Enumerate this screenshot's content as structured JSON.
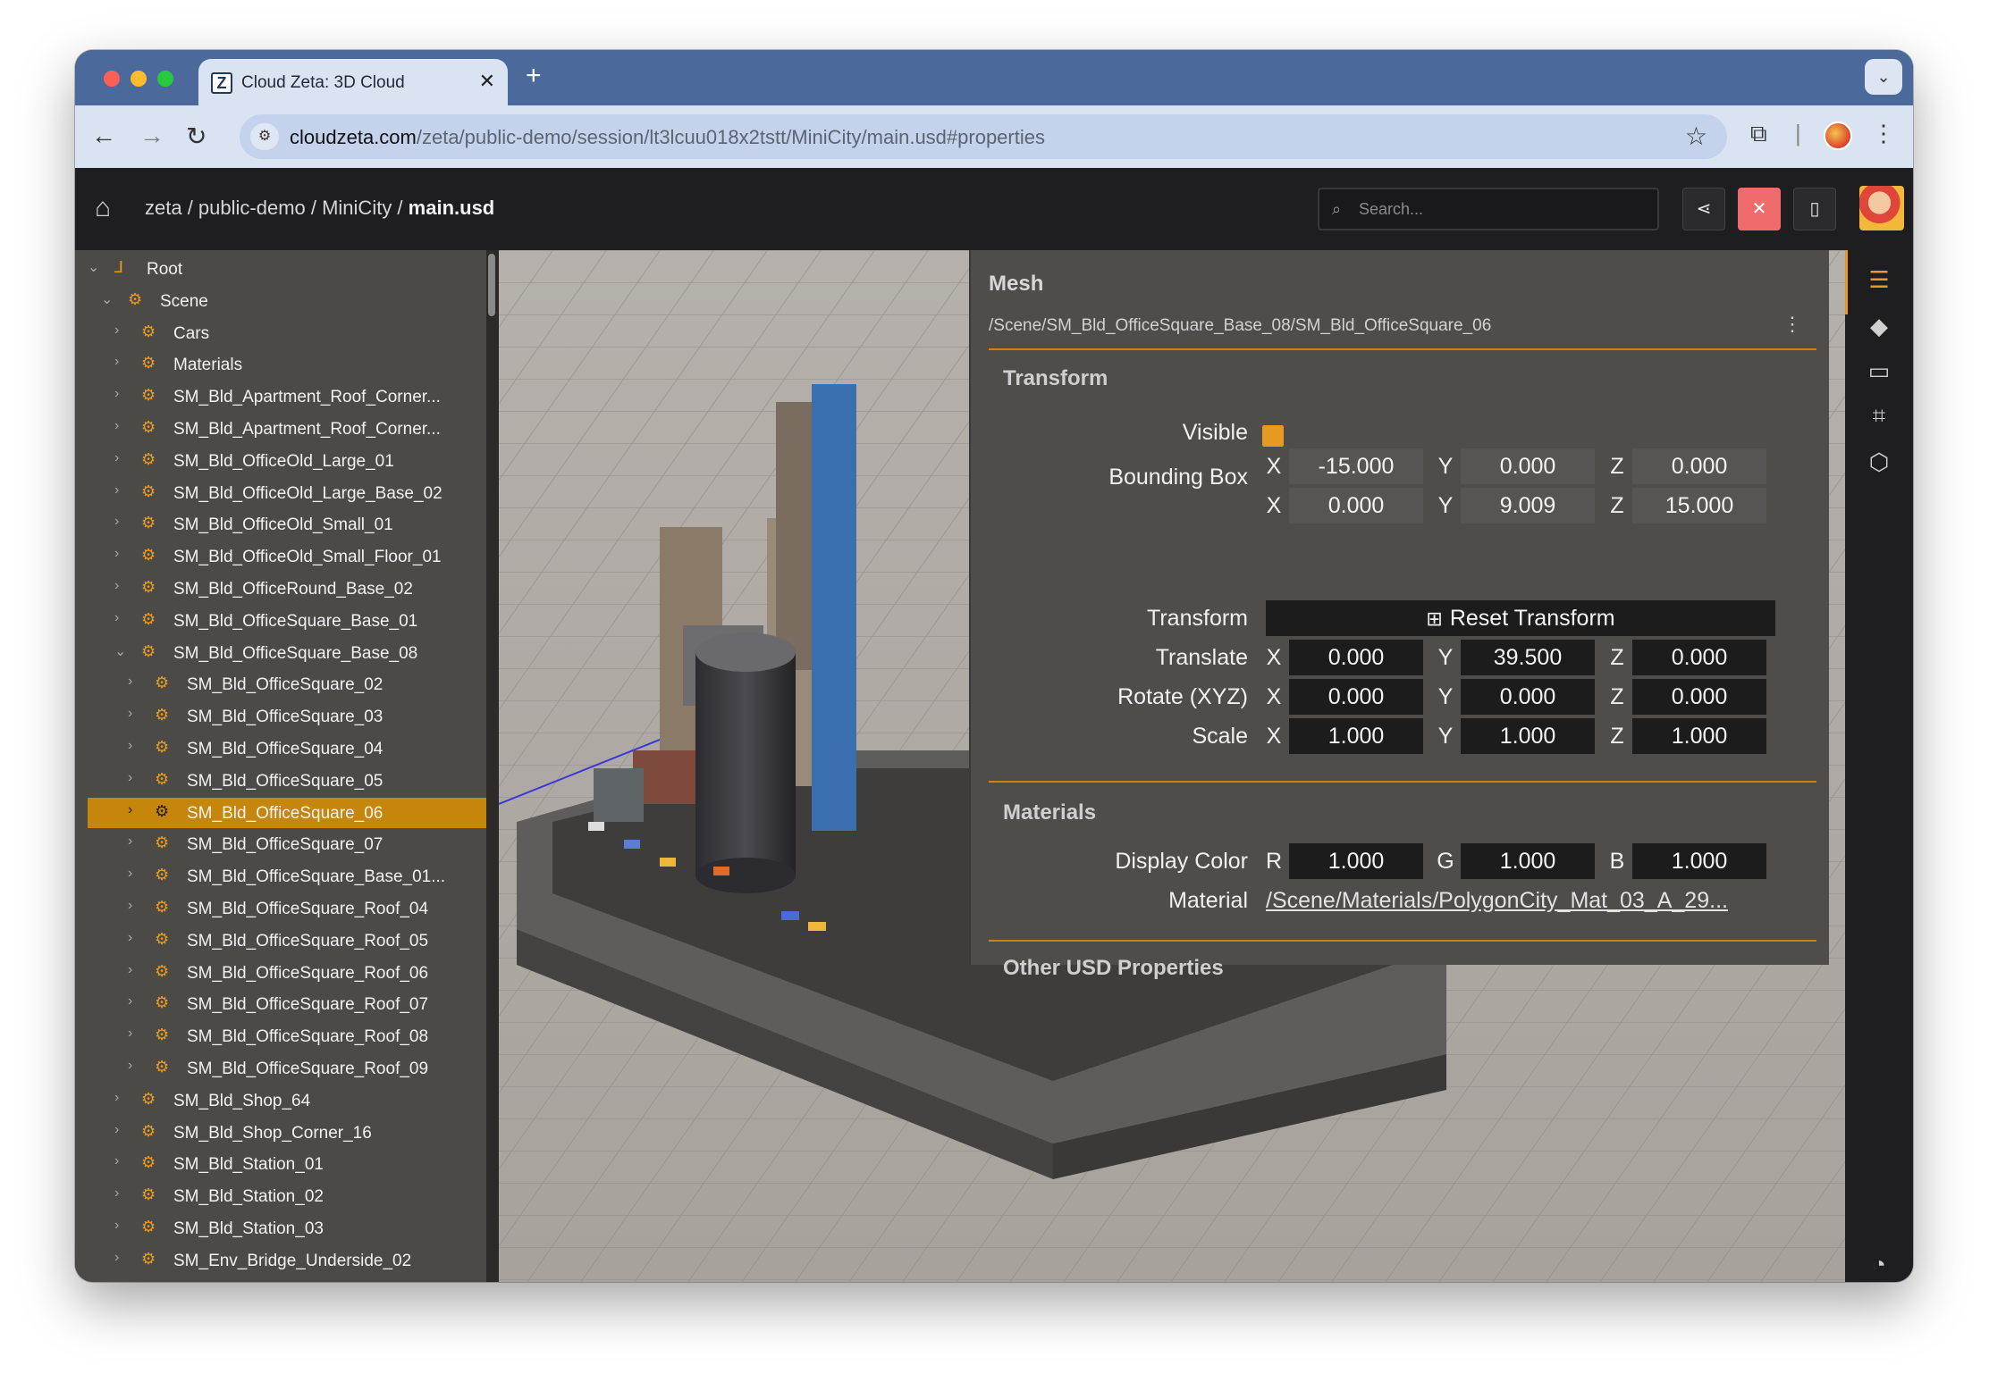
{
  "browser": {
    "tab_title": "Cloud Zeta: 3D Cloud",
    "tab_favicon": "Z",
    "url_host": "cloudzeta.com",
    "url_path": "/zeta/public-demo/session/lt3lcuu018x2tstt/MiniCity/main.usd#properties"
  },
  "header": {
    "breadcrumb": "zeta / public-demo / MiniCity / ",
    "breadcrumb_current": "main.usd",
    "search_placeholder": "Search..."
  },
  "tree": {
    "items": [
      {
        "label": "Root",
        "level": 0,
        "expanded": true
      },
      {
        "label": "Scene",
        "level": 1,
        "expanded": true
      },
      {
        "label": "Cars",
        "level": 2
      },
      {
        "label": "Materials",
        "level": 2
      },
      {
        "label": "SM_Bld_Apartment_Roof_Corner...",
        "level": 2
      },
      {
        "label": "SM_Bld_Apartment_Roof_Corner...",
        "level": 2
      },
      {
        "label": "SM_Bld_OfficeOld_Large_01",
        "level": 2
      },
      {
        "label": "SM_Bld_OfficeOld_Large_Base_02",
        "level": 2
      },
      {
        "label": "SM_Bld_OfficeOld_Small_01",
        "level": 2
      },
      {
        "label": "SM_Bld_OfficeOld_Small_Floor_01",
        "level": 2
      },
      {
        "label": "SM_Bld_OfficeRound_Base_02",
        "level": 2
      },
      {
        "label": "SM_Bld_OfficeSquare_Base_01",
        "level": 2
      },
      {
        "label": "SM_Bld_OfficeSquare_Base_08",
        "level": 2,
        "expanded": true
      },
      {
        "label": "SM_Bld_OfficeSquare_02",
        "level": 3
      },
      {
        "label": "SM_Bld_OfficeSquare_03",
        "level": 3
      },
      {
        "label": "SM_Bld_OfficeSquare_04",
        "level": 3
      },
      {
        "label": "SM_Bld_OfficeSquare_05",
        "level": 3
      },
      {
        "label": "SM_Bld_OfficeSquare_06",
        "level": 3,
        "selected": true
      },
      {
        "label": "SM_Bld_OfficeSquare_07",
        "level": 3
      },
      {
        "label": "SM_Bld_OfficeSquare_Base_01...",
        "level": 3
      },
      {
        "label": "SM_Bld_OfficeSquare_Roof_04",
        "level": 3
      },
      {
        "label": "SM_Bld_OfficeSquare_Roof_05",
        "level": 3
      },
      {
        "label": "SM_Bld_OfficeSquare_Roof_06",
        "level": 3
      },
      {
        "label": "SM_Bld_OfficeSquare_Roof_07",
        "level": 3
      },
      {
        "label": "SM_Bld_OfficeSquare_Roof_08",
        "level": 3
      },
      {
        "label": "SM_Bld_OfficeSquare_Roof_09",
        "level": 3
      },
      {
        "label": "SM_Bld_Shop_64",
        "level": 2
      },
      {
        "label": "SM_Bld_Shop_Corner_16",
        "level": 2
      },
      {
        "label": "SM_Bld_Station_01",
        "level": 2
      },
      {
        "label": "SM_Bld_Station_02",
        "level": 2
      },
      {
        "label": "SM_Bld_Station_03",
        "level": 2
      },
      {
        "label": "SM_Env_Bridge_Underside_02",
        "level": 2
      }
    ]
  },
  "props": {
    "title": "Mesh",
    "path": "/Scene/SM_Bld_OfficeSquare_Base_08/SM_Bld_OfficeSquare_06",
    "transform_section": "Transform",
    "visible_label": "Visible",
    "bbox_label": "Bounding Box",
    "bbox_min": {
      "x": "-15.000",
      "y": "0.000",
      "z": "0.000"
    },
    "bbox_max": {
      "x": "0.000",
      "y": "9.009",
      "z": "15.000"
    },
    "transform_label": "Transform",
    "reset_label": "Reset Transform",
    "translate_label": "Translate",
    "translate": {
      "x": "0.000",
      "y": "39.500",
      "z": "0.000"
    },
    "rotate_label": "Rotate (XYZ)",
    "rotate": {
      "x": "0.000",
      "y": "0.000",
      "z": "0.000"
    },
    "scale_label": "Scale",
    "scale": {
      "x": "1.000",
      "y": "1.000",
      "z": "1.000"
    },
    "materials_section": "Materials",
    "display_color_label": "Display Color",
    "display_color": {
      "r": "1.000",
      "g": "1.000",
      "b": "1.000"
    },
    "material_label": "Material",
    "material_value": "/Scene/Materials/PolygonCity_Mat_03_A_29...",
    "other_section": "Other USD Properties",
    "axes": {
      "x": "X",
      "y": "Y",
      "z": "Z",
      "r": "R",
      "g": "G",
      "b": "B"
    }
  },
  "icons": {
    "rail": [
      "sliders-icon",
      "layers-icon",
      "comment-icon",
      "qr-scan-icon",
      "settings-hex-icon",
      "gauge-icon"
    ]
  },
  "colors": {
    "accent": "#e79a22",
    "selection": "#c6860c",
    "close_button": "#f06b6b",
    "chrome_tabbar": "#4b6a9b"
  }
}
